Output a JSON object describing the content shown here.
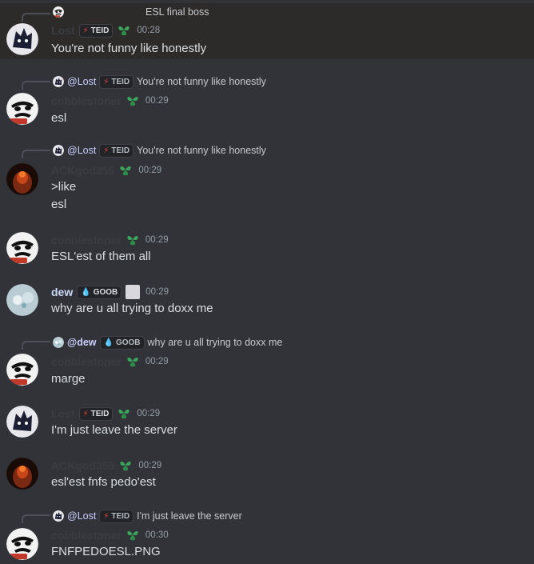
{
  "messages": [
    {
      "highlighted": true,
      "reply": {
        "author": "",
        "tag": "",
        "text": "ESL final boss"
      },
      "author": "Lost",
      "tag": "TEID",
      "time": "00:28",
      "lines": [
        "You're not funny like honestly"
      ]
    },
    {
      "reply": {
        "author": "@Lost",
        "tag": "TEID",
        "text": "You're not funny like honestly"
      },
      "author": "cobblestoner",
      "time": "00:29",
      "lines": [
        "esl"
      ]
    },
    {
      "reply": {
        "author": "@Lost",
        "tag": "TEID",
        "text": "You're not funny like honestly"
      },
      "author": "ACKgod355",
      "time": "00:29",
      "lines": [
        ">like",
        "esl"
      ]
    },
    {
      "author": "cobblestoner",
      "time": "00:29",
      "lines": [
        "ESL'est of them all"
      ]
    },
    {
      "author": "dew",
      "tag": "GOOB",
      "time": "00:29",
      "lines": [
        "why are u all trying to doxx me"
      ]
    },
    {
      "reply": {
        "author": "@dew",
        "tag": "GOOB",
        "text": "why are u all trying to doxx me"
      },
      "author": "cobblestoner",
      "time": "00:29",
      "lines": [
        "marge"
      ]
    },
    {
      "author": "Lost",
      "tag": "TEID",
      "time": "00:29",
      "lines": [
        "I'm just leave the server"
      ]
    },
    {
      "author": "ACKgod355",
      "time": "00:29",
      "lines": [
        "esl'est fnfs pedo'est"
      ]
    },
    {
      "reply": {
        "author": "@Lost",
        "tag": "TEID",
        "text": "I'm just leave the server"
      },
      "author": "cobblestoner",
      "time": "00:30",
      "lines": [
        "FNFPEDOESL.PNG"
      ]
    }
  ],
  "colors": {
    "background": "#313338",
    "highlight": "#2c2b2a",
    "role_bolt": "#f23f43",
    "role_drop": "#5ab5e8",
    "leaf": "#3ba55c"
  }
}
